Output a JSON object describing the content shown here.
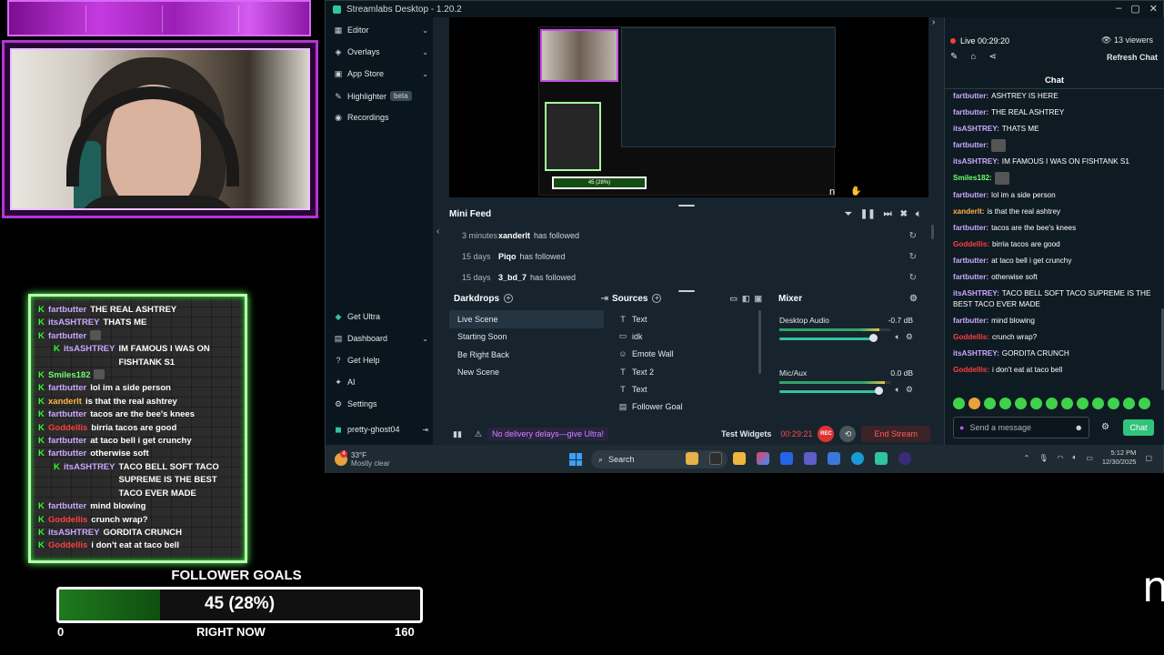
{
  "overlay": {
    "chat": [
      {
        "name": "fartbutter",
        "color": "#c9a8ff",
        "msg": "THE REAL ASHTREY",
        "indent": false
      },
      {
        "name": "itsASHTREY",
        "color": "#c9a8ff",
        "msg": "THATS ME",
        "indent": false
      },
      {
        "name": "fartbutter",
        "color": "#c9a8ff",
        "msg": "",
        "emote": true,
        "indent": false
      },
      {
        "name": "itsASHTREY",
        "color": "#c9a8ff",
        "msg": "IM FAMOUS I WAS ON FISHTANK S1",
        "indent": true
      },
      {
        "name": "Smiles182",
        "color": "#6cff6c",
        "msg": "",
        "emote": true,
        "indent": false
      },
      {
        "name": "fartbutter",
        "color": "#c9a8ff",
        "msg": "lol im a side person",
        "indent": false
      },
      {
        "name": "xanderlt",
        "color": "#ffb347",
        "msg": "is that the real ashtrey",
        "indent": false
      },
      {
        "name": "fartbutter",
        "color": "#c9a8ff",
        "msg": "tacos are the bee's knees",
        "indent": false
      },
      {
        "name": "Goddellis",
        "color": "#ff3f3f",
        "msg": "birria tacos are good",
        "indent": false
      },
      {
        "name": "fartbutter",
        "color": "#c9a8ff",
        "msg": "at taco bell i get crunchy",
        "indent": false
      },
      {
        "name": "fartbutter",
        "color": "#c9a8ff",
        "msg": "otherwise soft",
        "indent": false
      },
      {
        "name": "itsASHTREY",
        "color": "#c9a8ff",
        "msg": "TACO BELL SOFT TACO SUPREME IS THE BEST TACO EVER MADE",
        "indent": true
      },
      {
        "name": "fartbutter",
        "color": "#c9a8ff",
        "msg": "mind blowing",
        "indent": false
      },
      {
        "name": "Goddellis",
        "color": "#ff3f3f",
        "msg": "crunch wrap?",
        "indent": false
      },
      {
        "name": "itsASHTREY",
        "color": "#c9a8ff",
        "msg": "GORDITA CRUNCH",
        "indent": false
      },
      {
        "name": "Goddellis",
        "color": "#ff3f3f",
        "msg": "i don't eat at taco bell",
        "indent": false
      }
    ],
    "goal": {
      "title": "FOLLOWER GOALS",
      "display": "45 (28%)",
      "current": 45,
      "target": 160,
      "fraction": 0.28,
      "min_label": "0",
      "max_label": "160",
      "sub_label": "RIGHT NOW"
    },
    "corner_text": "n"
  },
  "app": {
    "title": "Streamlabs Desktop - 1.20.2",
    "nav": {
      "editor": "Editor",
      "overlays": "Overlays",
      "app_store": "App Store",
      "highlighter": "Highlighter",
      "beta": "beta",
      "recordings": "Recordings",
      "get_ultra": "Get Ultra",
      "dashboard": "Dashboard",
      "get_help": "Get Help",
      "ai": "AI",
      "settings": "Settings",
      "user": "pretty-ghost04"
    },
    "preview": {
      "goal_text": "45 (28%)",
      "corner": "n"
    },
    "minifeed": {
      "title": "Mini Feed",
      "rows": [
        {
          "time": "3 minutes",
          "user": "xanderlt",
          "action": "has followed"
        },
        {
          "time": "15 days",
          "user": "Piqo",
          "action": "has followed"
        },
        {
          "time": "15 days",
          "user": "3_bd_7",
          "action": "has followed"
        }
      ]
    },
    "scenes": {
      "title": "Darkdrops",
      "items": [
        "Live Scene",
        "Starting Soon",
        "Be Right Back",
        "New Scene"
      ],
      "active": 0
    },
    "sources": {
      "title": "Sources",
      "items": [
        {
          "icon": "text-icon",
          "glyph": "T",
          "label": "Text"
        },
        {
          "icon": "monitor-icon",
          "glyph": "▭",
          "label": "idk"
        },
        {
          "icon": "emote-icon",
          "glyph": "☺",
          "label": "Emote Wall"
        },
        {
          "icon": "text-icon",
          "glyph": "T",
          "label": "Text 2"
        },
        {
          "icon": "text-icon",
          "glyph": "T",
          "label": "Text"
        },
        {
          "icon": "goal-icon",
          "glyph": "▤",
          "label": "Follower Goal"
        }
      ]
    },
    "mixer": {
      "title": "Mixer",
      "channels": [
        {
          "label": "Desktop Audio",
          "db": "-0.7 dB",
          "level": 0.9
        },
        {
          "label": "Mic/Aux",
          "db": "0.0 dB",
          "level": 0.95
        }
      ]
    },
    "footer": {
      "promo": "No delivery delays—give Ultra!",
      "test_widgets": "Test Widgets",
      "timer": "00:29:21",
      "rec": "REC",
      "end_stream": "End Stream"
    },
    "chat": {
      "live": "Live 00:29:20",
      "viewers": "13 viewers",
      "refresh": "Refresh Chat",
      "title": "Chat",
      "messages": [
        {
          "name": "fartbutter",
          "color": "#c9a8ff",
          "msg": "ASHTREY IS HERE"
        },
        {
          "name": "fartbutter",
          "color": "#c9a8ff",
          "msg": "THE REAL ASHTREY"
        },
        {
          "name": "itsASHTREY",
          "color": "#c9a8ff",
          "msg": "THATS ME"
        },
        {
          "name": "fartbutter",
          "color": "#c9a8ff",
          "msg": "",
          "emote": true
        },
        {
          "name": "itsASHTREY",
          "color": "#c9a8ff",
          "msg": "IM FAMOUS I WAS ON FISHTANK S1"
        },
        {
          "name": "Smiles182",
          "color": "#6cff6c",
          "msg": "",
          "emote": true
        },
        {
          "name": "fartbutter",
          "color": "#c9a8ff",
          "msg": "lol im a side person"
        },
        {
          "name": "xanderlt",
          "color": "#ffb347",
          "msg": "is that the real ashtrey"
        },
        {
          "name": "fartbutter",
          "color": "#c9a8ff",
          "msg": "tacos are the bee's knees"
        },
        {
          "name": "Goddellis",
          "color": "#ff3f3f",
          "msg": "birria tacos are good"
        },
        {
          "name": "fartbutter",
          "color": "#c9a8ff",
          "msg": "at taco bell i get crunchy"
        },
        {
          "name": "fartbutter",
          "color": "#c9a8ff",
          "msg": "otherwise soft"
        },
        {
          "name": "itsASHTREY",
          "color": "#c9a8ff",
          "msg": "TACO BELL SOFT TACO SUPREME IS THE BEST TACO EVER MADE",
          "two": true
        },
        {
          "name": "fartbutter",
          "color": "#c9a8ff",
          "msg": "mind blowing"
        },
        {
          "name": "Goddellis",
          "color": "#ff3f3f",
          "msg": "crunch wrap?"
        },
        {
          "name": "itsASHTREY",
          "color": "#c9a8ff",
          "msg": "GORDITA CRUNCH"
        },
        {
          "name": "Goddellis",
          "color": "#ff3f3f",
          "msg": "i don't eat at taco bell"
        }
      ],
      "placeholder": "Send a message",
      "send": "Chat"
    }
  },
  "taskbar": {
    "temp": "33°F",
    "weather": "Mostly clear",
    "weather_badge": "4",
    "search": "Search",
    "time": "5:12 PM",
    "date": "12/30/2025"
  }
}
